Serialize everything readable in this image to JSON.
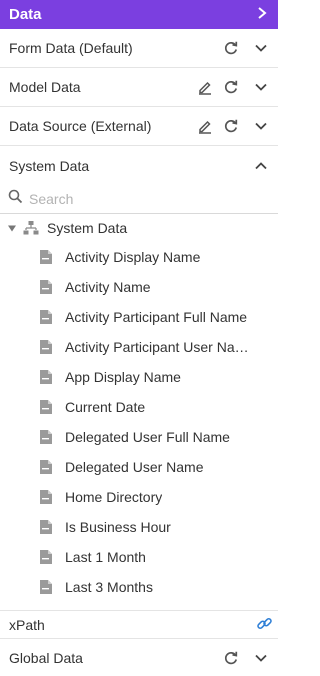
{
  "header": {
    "title": "Data",
    "chevron_icon": "chevron-right-icon"
  },
  "sections": {
    "form_data": {
      "label": "Form Data (Default)"
    },
    "model_data": {
      "label": "Model Data"
    },
    "data_source": {
      "label": "Data Source (External)"
    },
    "system_data": {
      "label": "System Data",
      "expanded": true
    },
    "global_data": {
      "label": "Global Data"
    }
  },
  "search": {
    "placeholder": "Search",
    "value": ""
  },
  "tree": {
    "root_label": "System Data",
    "items": [
      "Activity Display Name",
      "Activity Name",
      "Activity Participant Full Name",
      "Activity Participant User Name",
      "App Display Name",
      "Current Date",
      "Delegated User Full Name",
      "Delegated User Name",
      "Home Directory",
      "Is Business Hour",
      "Last 1 Month",
      "Last 3 Months"
    ]
  },
  "xpath": {
    "label": "xPath",
    "icon": "link-icon"
  },
  "colors": {
    "header_bg": "#7b3fe0",
    "link": "#2f7fd6",
    "icon_gray": "#555555"
  }
}
